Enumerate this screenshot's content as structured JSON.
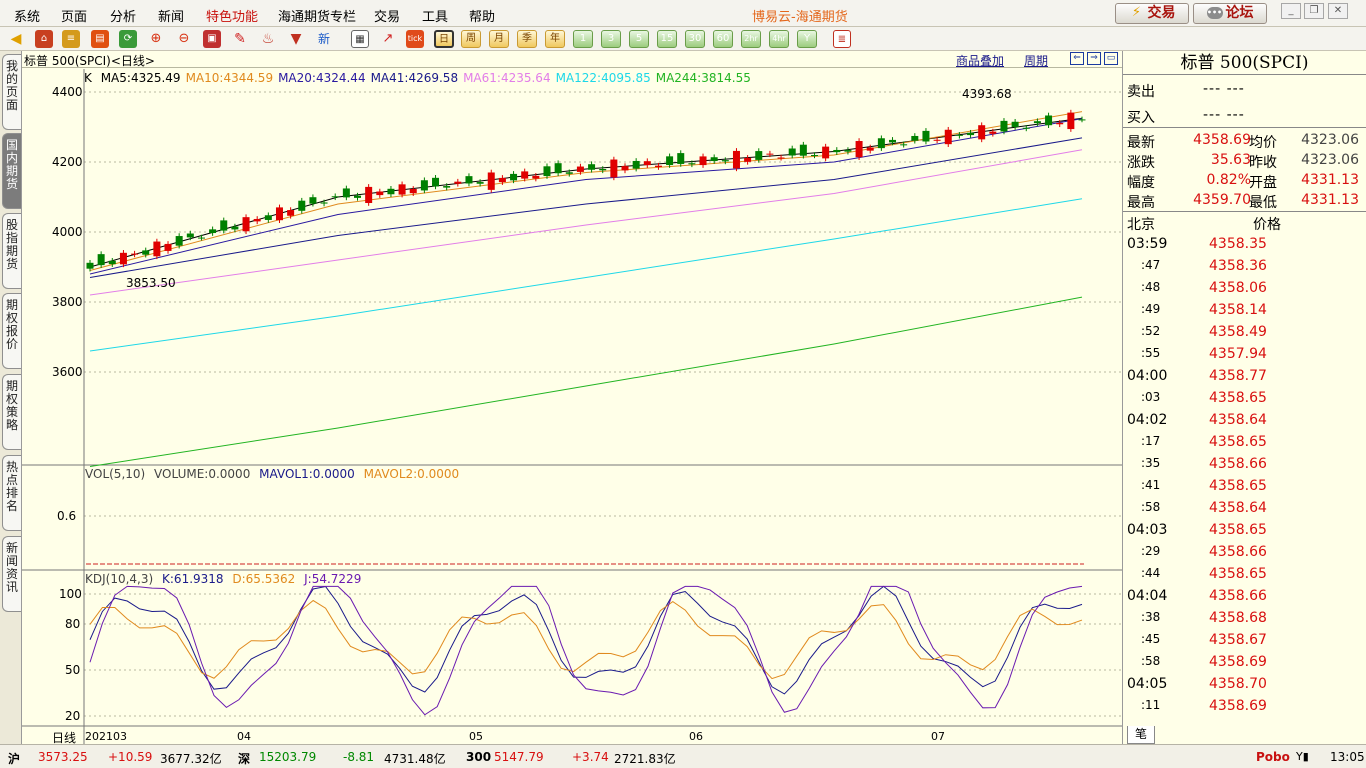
{
  "menu": [
    "系统",
    "页面",
    "分析",
    "新闻",
    "特色功能",
    "海通期货专栏",
    "交易",
    "工具",
    "帮助"
  ],
  "app_title": "博易云-海通期货",
  "top_buttons": {
    "trade": "交易",
    "forum": "论坛"
  },
  "toolbar": {
    "periods": [
      "日",
      "周",
      "月",
      "季",
      "年"
    ],
    "minutes": [
      "1",
      "3",
      "5",
      "15",
      "30",
      "60",
      "2hr",
      "4hr",
      "Y"
    ]
  },
  "left_tabs": [
    "我的页面",
    "国内期货",
    "股指期货",
    "期权报价",
    "期权策略",
    "热点排名",
    "新闻资讯"
  ],
  "chart": {
    "title": "标普 500(SPCI)<日线>",
    "overlay_link": "商品叠加",
    "period_link": "周期",
    "k_label": "K",
    "ma": [
      {
        "label": "MA5:4325.49",
        "color": "#000000"
      },
      {
        "label": "MA10:4344.59",
        "color": "#e08a1e"
      },
      {
        "label": "MA20:4324.44",
        "color": "#2a1aa0"
      },
      {
        "label": "MA41:4269.58",
        "color": "#1a1a8a"
      },
      {
        "label": "MA61:4235.64",
        "color": "#e27ee8"
      },
      {
        "label": "MA122:4095.85",
        "color": "#1ed8e8"
      },
      {
        "label": "MA244:3814.55",
        "color": "#22b422"
      }
    ],
    "price_ticks": [
      "4400",
      "4200",
      "4000",
      "3800",
      "3600"
    ],
    "high_label": "4393.68",
    "low_label": "3853.50",
    "vol": {
      "label": "VOL(5,10)",
      "volume": "VOLUME:0.0000",
      "mavol1": "MAVOL1:0.0000",
      "mavol2": "MAVOL2:0.0000",
      "tick": "0.6"
    },
    "kdj": {
      "label": "KDJ(10,4,3)",
      "k": "K:61.9318",
      "d": "D:65.5362",
      "j": "J:54.7229",
      "ticks": [
        "100",
        "80",
        "50",
        "20"
      ]
    },
    "x_axis": {
      "period": "日线",
      "labels": [
        "202103",
        "04",
        "05",
        "06",
        "07"
      ]
    }
  },
  "chart_data": {
    "type": "line",
    "title": "标普 500(SPCI)<日线>",
    "xlabel": "",
    "ylabel": "",
    "x": [
      "202103",
      "04",
      "05",
      "06",
      "07"
    ],
    "ylim": [
      3400,
      4450
    ],
    "series": [
      {
        "name": "MA5",
        "values": [
          3900,
          4100,
          4180,
          4230,
          4325
        ]
      },
      {
        "name": "MA10",
        "values": [
          3890,
          4080,
          4170,
          4220,
          4344
        ]
      },
      {
        "name": "MA20",
        "values": [
          3880,
          4050,
          4150,
          4200,
          4324
        ]
      },
      {
        "name": "MA41",
        "values": [
          3870,
          3990,
          4080,
          4150,
          4269
        ]
      },
      {
        "name": "MA61",
        "values": [
          3820,
          3920,
          4020,
          4110,
          4235
        ]
      },
      {
        "name": "MA122",
        "values": [
          3660,
          3760,
          3870,
          3980,
          4095
        ]
      },
      {
        "name": "MA244",
        "values": [
          3330,
          3440,
          3560,
          3680,
          3814
        ]
      }
    ]
  },
  "panel": {
    "title": "标普 500(SPCI)",
    "ask_label": "卖出",
    "ask_value": "---  ---",
    "bid_label": "买入",
    "bid_value": "---  ---",
    "stats": [
      {
        "l1": "最新",
        "v1": "4358.69",
        "l2": "均价",
        "v2": "4323.06"
      },
      {
        "l1": "涨跌",
        "v1": "35.63",
        "l2": "昨收",
        "v2": "4323.06"
      },
      {
        "l1": "幅度",
        "v1": "0.82%",
        "l2": "开盘",
        "v2": "4331.13"
      },
      {
        "l1": "最高",
        "v1": "4359.70",
        "l2": "最低",
        "v2": "4331.13"
      }
    ],
    "ticks_header": {
      "time": "北京",
      "price": "价格"
    },
    "ticks": [
      {
        "t": "03:59",
        "p": "4358.35"
      },
      {
        "t": ":47",
        "p": "4358.36"
      },
      {
        "t": ":48",
        "p": "4358.06"
      },
      {
        "t": ":49",
        "p": "4358.14"
      },
      {
        "t": ":52",
        "p": "4358.49"
      },
      {
        "t": ":55",
        "p": "4357.94"
      },
      {
        "t": "04:00",
        "p": "4358.77"
      },
      {
        "t": ":03",
        "p": "4358.65"
      },
      {
        "t": "04:02",
        "p": "4358.64"
      },
      {
        "t": ":17",
        "p": "4358.65"
      },
      {
        "t": ":35",
        "p": "4358.66"
      },
      {
        "t": ":41",
        "p": "4358.65"
      },
      {
        "t": ":58",
        "p": "4358.64"
      },
      {
        "t": "04:03",
        "p": "4358.65"
      },
      {
        "t": ":29",
        "p": "4358.66"
      },
      {
        "t": ":44",
        "p": "4358.65"
      },
      {
        "t": "04:04",
        "p": "4358.66"
      },
      {
        "t": ":38",
        "p": "4358.68"
      },
      {
        "t": ":45",
        "p": "4358.67"
      },
      {
        "t": ":58",
        "p": "4358.69"
      },
      {
        "t": "04:05",
        "p": "4358.70"
      },
      {
        "t": ":11",
        "p": "4358.69"
      }
    ],
    "bottom_tab": "笔"
  },
  "status": {
    "sh": {
      "name": "沪",
      "value": "3573.25",
      "change": "+10.59",
      "amount": "3677.32亿"
    },
    "sz": {
      "name": "深",
      "value": "15203.79",
      "change": "-8.81",
      "amount": "4731.48亿"
    },
    "c300": {
      "name": "300",
      "value": "5147.79",
      "change": "+3.74",
      "amount": "2721.83亿"
    },
    "brand": "Pobo",
    "time": "13:05"
  }
}
